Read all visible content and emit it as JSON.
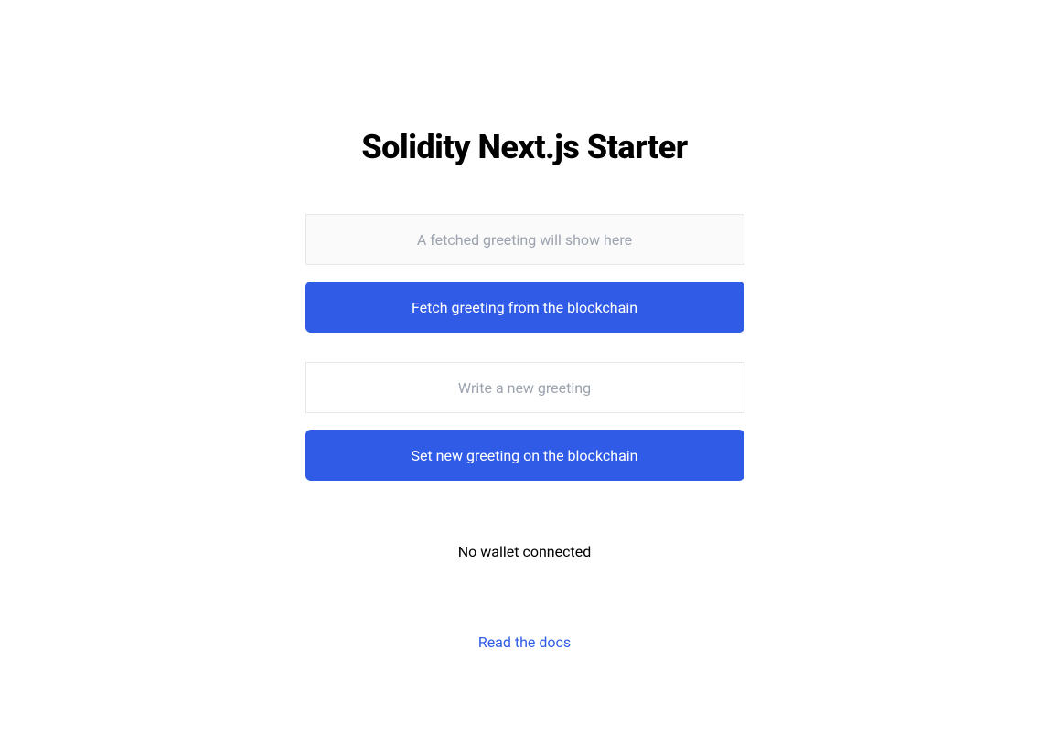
{
  "title": "Solidity Next.js Starter",
  "fetch": {
    "placeholder": "A fetched greeting will show here",
    "button_label": "Fetch greeting from the blockchain"
  },
  "write": {
    "placeholder": "Write a new greeting",
    "value": "",
    "button_label": "Set new greeting on the blockchain"
  },
  "wallet": {
    "status": "No wallet connected"
  },
  "footer": {
    "docs_link": "Read the docs"
  }
}
